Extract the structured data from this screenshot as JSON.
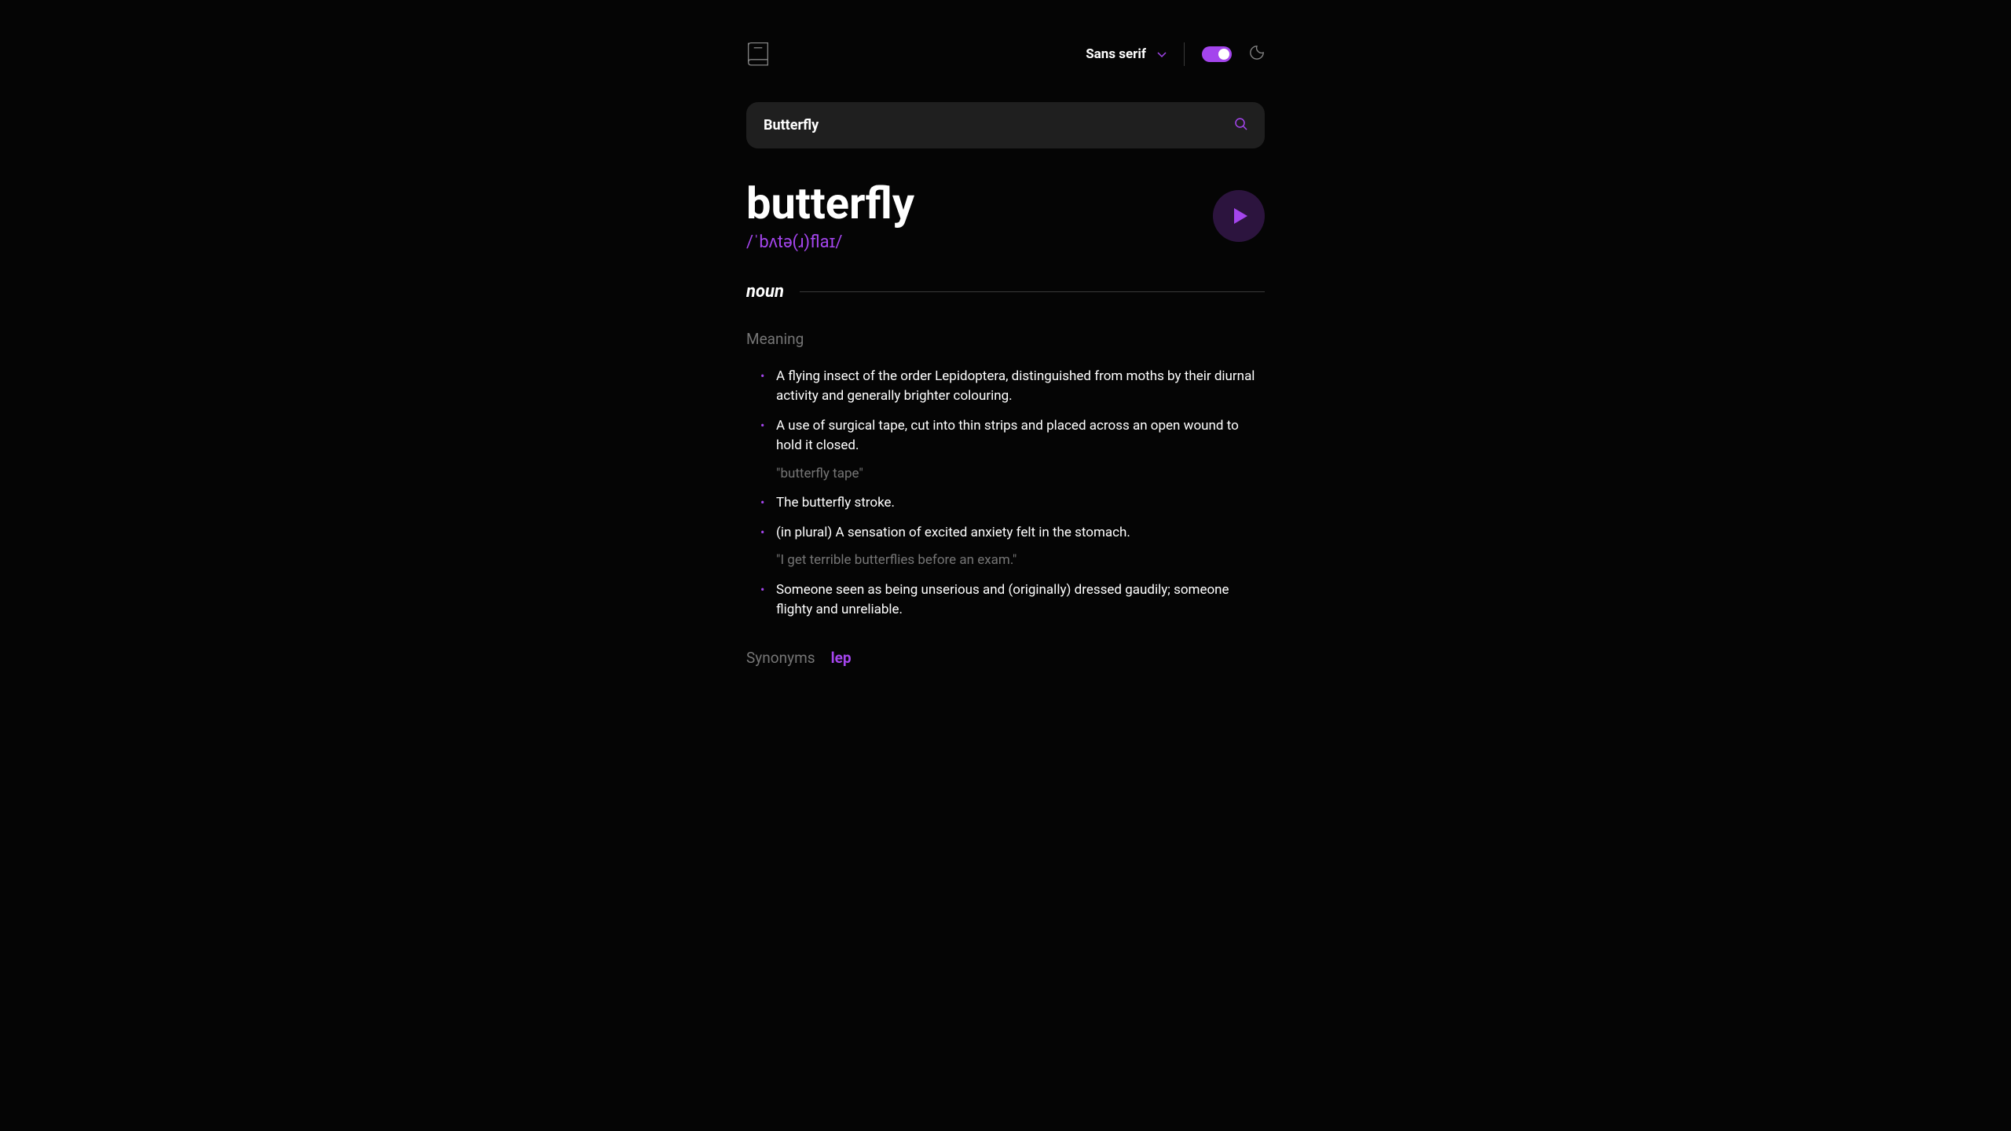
{
  "header": {
    "font_label": "Sans serif"
  },
  "search": {
    "value": "Butterfly"
  },
  "word": {
    "title": "butterfly",
    "phonetic": "/ˈbʌtə(ɹ)flaɪ/"
  },
  "pos": "noun",
  "meaning_label": "Meaning",
  "definitions": [
    {
      "text": "A flying insect of the order Lepidoptera, distinguished from moths by their diurnal activity and generally brighter colouring.",
      "example": null
    },
    {
      "text": "A use of surgical tape, cut into thin strips and placed across an open wound to hold it closed.",
      "example": "\"butterfly tape\""
    },
    {
      "text": "The butterfly stroke.",
      "example": null
    },
    {
      "text": "(in plural) A sensation of excited anxiety felt in the stomach.",
      "example": "\"I get terrible butterflies before an exam.\""
    },
    {
      "text": "Someone seen as being unserious and (originally) dressed gaudily; someone flighty and unreliable.",
      "example": null
    }
  ],
  "synonyms_label": "Synonyms",
  "synonyms": [
    "lep"
  ]
}
